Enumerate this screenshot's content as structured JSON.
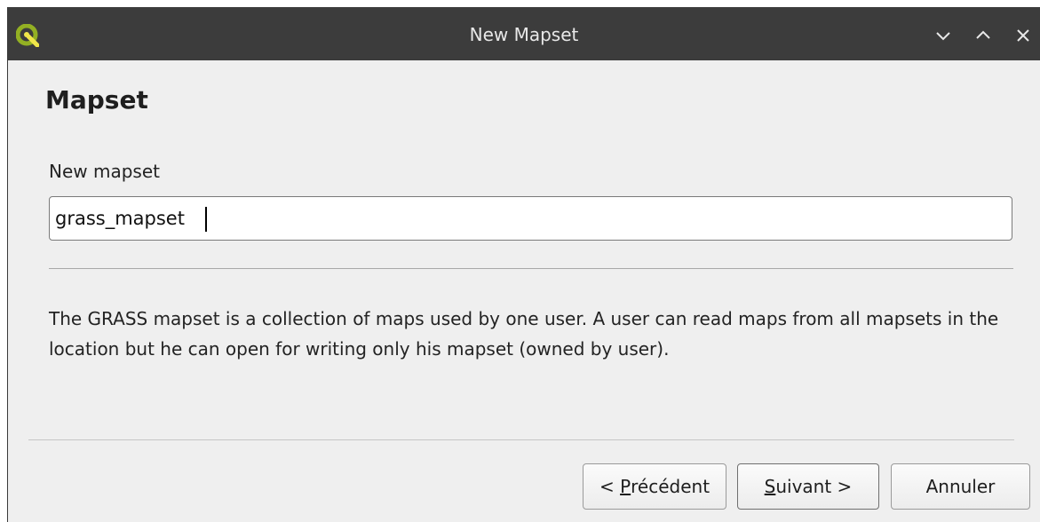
{
  "window": {
    "title": "New Mapset",
    "app_icon": "qgis-logo-icon",
    "controls": [
      "minimize-icon",
      "maximize-icon",
      "close-icon"
    ]
  },
  "page": {
    "heading": "Mapset",
    "field_label": "New mapset",
    "mapset_value": "grass_mapset",
    "description": "The GRASS mapset is a collection of maps used by one user. A user can read maps from all mapsets in the location but he can open for writing only his mapset (owned by user)."
  },
  "buttons": {
    "prev_prefix": "< ",
    "prev_mnemonic": "P",
    "prev_rest": "récédent",
    "next_mnemonic": "S",
    "next_rest": "uivant >",
    "cancel": "Annuler"
  },
  "colors": {
    "titlebar": "#3c3c3c",
    "qgis_green": "#93b023",
    "qgis_yellow": "#f0e64a"
  }
}
